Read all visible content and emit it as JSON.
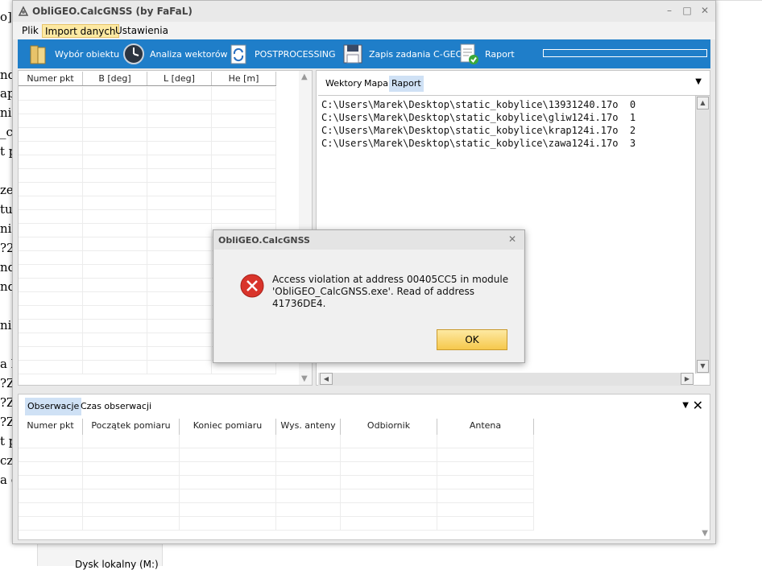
{
  "background": {
    "left_fragments": [
      "o]",
      "nd",
      "ap",
      "nia",
      "_c",
      "t p",
      "ze",
      "tu",
      "nia",
      "?2",
      "nd",
      "nd",
      "ni",
      "a l",
      "?Z",
      "?Z",
      "?Z",
      "t p",
      "cze",
      "a c"
    ],
    "disk_label": "Dysk lokalny (M:)"
  },
  "window": {
    "title": "ObliGEO.CalcGNSS (by FaFaL)",
    "controls": {
      "minimize": "–",
      "maximize": "□",
      "close": "✕"
    }
  },
  "menu": {
    "items": [
      "Plik",
      "Import danych",
      "Ustawienia"
    ]
  },
  "toolbar": {
    "items": [
      {
        "label": "Wybór obiektu",
        "icon": "folder-icon"
      },
      {
        "label": "Analiza wektorów",
        "icon": "clock-icon"
      },
      {
        "label": "POSTPROCESSING",
        "icon": "refresh-doc-icon"
      },
      {
        "label": "Zapis zadania C-GEO",
        "icon": "floppy-icon"
      },
      {
        "label": "Raport",
        "icon": "report-check-icon"
      }
    ]
  },
  "left_grid": {
    "columns": [
      "Numer pkt",
      "B [deg]",
      "L [deg]",
      "He [m]"
    ]
  },
  "right_panel": {
    "tabs": [
      "Wektory",
      "Mapa",
      "Raport"
    ],
    "active_tab": "Raport",
    "lines": [
      "C:\\Users\\Marek\\Desktop\\static_kobylice\\13931240.17o  0",
      "C:\\Users\\Marek\\Desktop\\static_kobylice\\gliw124i.17o  1",
      "C:\\Users\\Marek\\Desktop\\static_kobylice\\krap124i.17o  2",
      "C:\\Users\\Marek\\Desktop\\static_kobylice\\zawa124i.17o  3"
    ]
  },
  "bottom_panel": {
    "tabs": [
      "Obserwacje",
      "Czas obserwacji"
    ],
    "active_tab": "Obserwacje",
    "columns": [
      "Numer pkt",
      "Początek pomiaru",
      "Koniec pomiaru",
      "Wys. anteny",
      "Odbiornik",
      "Antena"
    ]
  },
  "dialog": {
    "title": "ObliGEO.CalcGNSS",
    "message_line1": "Access violation at address 00405CC5 in module",
    "message_line2": "'ObliGEO_CalcGNSS.exe'. Read of address 41736DE4.",
    "ok_label": "OK",
    "icon": "error-icon"
  },
  "colors": {
    "toolbar_bg": "#1f7ec9",
    "menu_active_bg": "#fde9a2",
    "tab_active_bg": "#cfe1f5",
    "error_red": "#d9342b"
  }
}
